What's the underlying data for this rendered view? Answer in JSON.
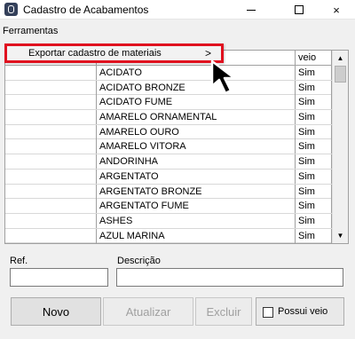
{
  "window": {
    "title": "Cadastro de Acabamentos",
    "icon": "app-icon",
    "controls": {
      "minimize": "minimize-icon",
      "maximize": "maximize-icon",
      "close": "×"
    }
  },
  "menubar": {
    "items": [
      "Ferramentas"
    ]
  },
  "context_menu": {
    "item_label": "Exportar cadastro de materiais",
    "submenu_arrow": ">",
    "highlight_color": "#e0101f"
  },
  "grid": {
    "columns": [
      "",
      "",
      "veio"
    ],
    "rows": [
      [
        "",
        "ACIDATO",
        "Sim"
      ],
      [
        "",
        "ACIDATO BRONZE",
        "Sim"
      ],
      [
        "",
        "ACIDATO FUME",
        "Sim"
      ],
      [
        "",
        "AMARELO ORNAMENTAL",
        "Sim"
      ],
      [
        "",
        "AMARELO OURO",
        "Sim"
      ],
      [
        "",
        "AMARELO VITORA",
        "Sim"
      ],
      [
        "",
        "ANDORINHA",
        "Sim"
      ],
      [
        "",
        "ARGENTATO",
        "Sim"
      ],
      [
        "",
        "ARGENTATO BRONZE",
        "Sim"
      ],
      [
        "",
        "ARGENTATO FUME",
        "Sim"
      ],
      [
        "",
        "ASHES",
        "Sim"
      ],
      [
        "",
        "AZUL MARINA",
        "Sim"
      ]
    ],
    "scrollbar": {
      "up": "▲",
      "down": "▼"
    }
  },
  "form": {
    "ref_label": "Ref.",
    "ref_value": "",
    "descricao_label": "Descrição",
    "descricao_value": ""
  },
  "buttons": {
    "novo": "Novo",
    "atualizar": "Atualizar",
    "excluir": "Excluir",
    "possui_veio": "Possui veio"
  }
}
